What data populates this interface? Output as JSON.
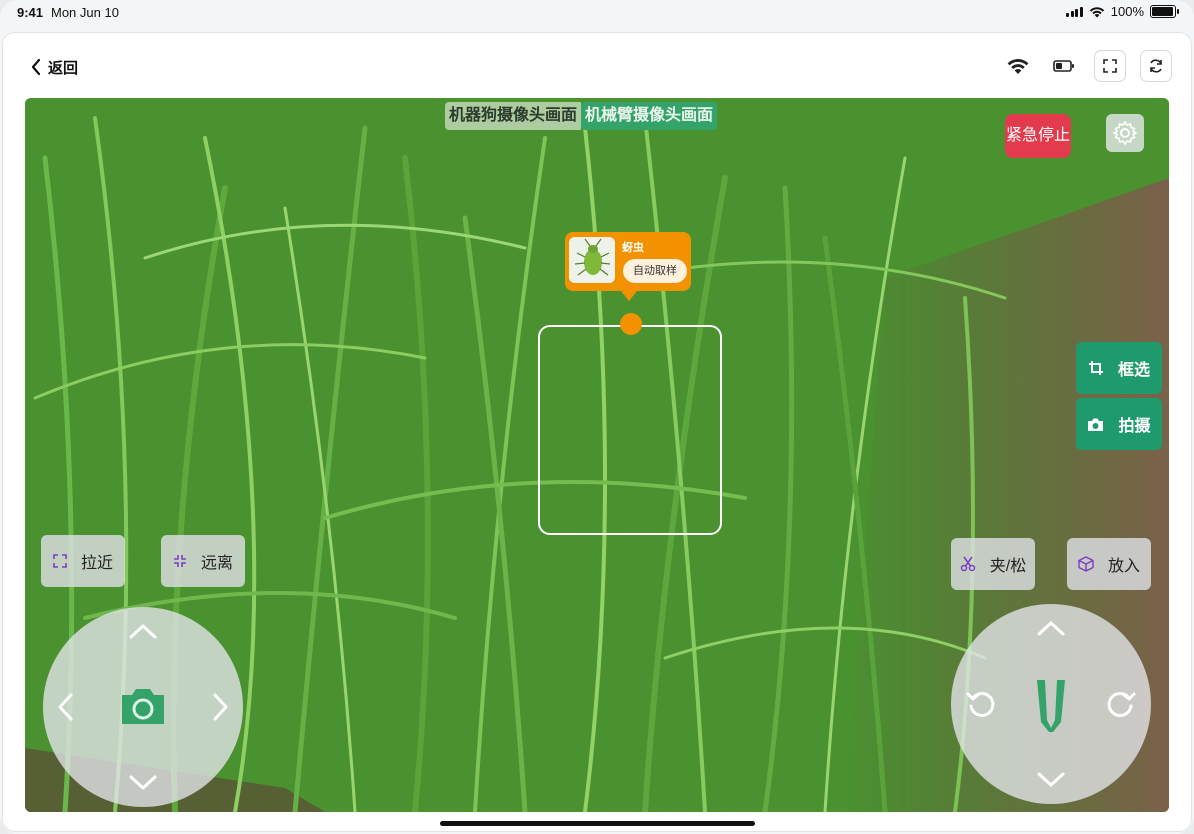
{
  "status_bar": {
    "time": "9:41",
    "date": "Mon Jun 10",
    "battery": "100%"
  },
  "header": {
    "back_label": "返回",
    "icons": [
      "wifi-icon",
      "battery-icon",
      "fullscreen-icon",
      "refresh-icon"
    ]
  },
  "camera": {
    "tabs": [
      {
        "label": "机器狗摄像头画面",
        "active": false
      },
      {
        "label": "机械臂摄像头画面",
        "active": true
      }
    ],
    "emergency_stop": "紧急停止",
    "detection": {
      "pest_name": "蚜虫",
      "action_label": "自动取样"
    },
    "side_actions": [
      {
        "label": "框选",
        "icon": "crop-icon"
      },
      {
        "label": "拍摄",
        "icon": "camera-icon"
      }
    ],
    "zoom_in": "拉近",
    "zoom_out": "远离",
    "grip": "夹/松",
    "place": "放入"
  },
  "colors": {
    "accent": "#1e9a6c",
    "tab_active": "#34a36a",
    "emergency": "#e23b4e",
    "detection_tag": "#f39200",
    "icon_purple": "#7a3fc4"
  }
}
